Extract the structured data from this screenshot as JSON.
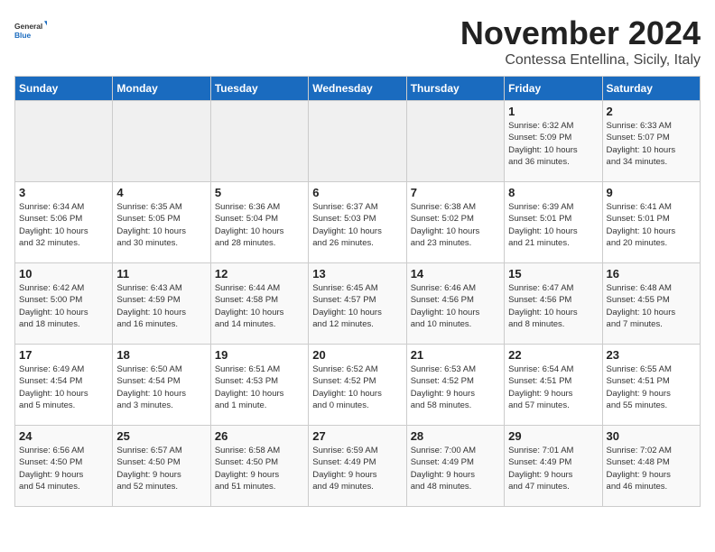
{
  "logo": {
    "general": "General",
    "blue": "Blue"
  },
  "title": "November 2024",
  "subtitle": "Contessa Entellina, Sicily, Italy",
  "weekdays": [
    "Sunday",
    "Monday",
    "Tuesday",
    "Wednesday",
    "Thursday",
    "Friday",
    "Saturday"
  ],
  "weeks": [
    [
      {
        "day": "",
        "info": ""
      },
      {
        "day": "",
        "info": ""
      },
      {
        "day": "",
        "info": ""
      },
      {
        "day": "",
        "info": ""
      },
      {
        "day": "",
        "info": ""
      },
      {
        "day": "1",
        "info": "Sunrise: 6:32 AM\nSunset: 5:09 PM\nDaylight: 10 hours\nand 36 minutes."
      },
      {
        "day": "2",
        "info": "Sunrise: 6:33 AM\nSunset: 5:07 PM\nDaylight: 10 hours\nand 34 minutes."
      }
    ],
    [
      {
        "day": "3",
        "info": "Sunrise: 6:34 AM\nSunset: 5:06 PM\nDaylight: 10 hours\nand 32 minutes."
      },
      {
        "day": "4",
        "info": "Sunrise: 6:35 AM\nSunset: 5:05 PM\nDaylight: 10 hours\nand 30 minutes."
      },
      {
        "day": "5",
        "info": "Sunrise: 6:36 AM\nSunset: 5:04 PM\nDaylight: 10 hours\nand 28 minutes."
      },
      {
        "day": "6",
        "info": "Sunrise: 6:37 AM\nSunset: 5:03 PM\nDaylight: 10 hours\nand 26 minutes."
      },
      {
        "day": "7",
        "info": "Sunrise: 6:38 AM\nSunset: 5:02 PM\nDaylight: 10 hours\nand 23 minutes."
      },
      {
        "day": "8",
        "info": "Sunrise: 6:39 AM\nSunset: 5:01 PM\nDaylight: 10 hours\nand 21 minutes."
      },
      {
        "day": "9",
        "info": "Sunrise: 6:41 AM\nSunset: 5:01 PM\nDaylight: 10 hours\nand 20 minutes."
      }
    ],
    [
      {
        "day": "10",
        "info": "Sunrise: 6:42 AM\nSunset: 5:00 PM\nDaylight: 10 hours\nand 18 minutes."
      },
      {
        "day": "11",
        "info": "Sunrise: 6:43 AM\nSunset: 4:59 PM\nDaylight: 10 hours\nand 16 minutes."
      },
      {
        "day": "12",
        "info": "Sunrise: 6:44 AM\nSunset: 4:58 PM\nDaylight: 10 hours\nand 14 minutes."
      },
      {
        "day": "13",
        "info": "Sunrise: 6:45 AM\nSunset: 4:57 PM\nDaylight: 10 hours\nand 12 minutes."
      },
      {
        "day": "14",
        "info": "Sunrise: 6:46 AM\nSunset: 4:56 PM\nDaylight: 10 hours\nand 10 minutes."
      },
      {
        "day": "15",
        "info": "Sunrise: 6:47 AM\nSunset: 4:56 PM\nDaylight: 10 hours\nand 8 minutes."
      },
      {
        "day": "16",
        "info": "Sunrise: 6:48 AM\nSunset: 4:55 PM\nDaylight: 10 hours\nand 7 minutes."
      }
    ],
    [
      {
        "day": "17",
        "info": "Sunrise: 6:49 AM\nSunset: 4:54 PM\nDaylight: 10 hours\nand 5 minutes."
      },
      {
        "day": "18",
        "info": "Sunrise: 6:50 AM\nSunset: 4:54 PM\nDaylight: 10 hours\nand 3 minutes."
      },
      {
        "day": "19",
        "info": "Sunrise: 6:51 AM\nSunset: 4:53 PM\nDaylight: 10 hours\nand 1 minute."
      },
      {
        "day": "20",
        "info": "Sunrise: 6:52 AM\nSunset: 4:52 PM\nDaylight: 10 hours\nand 0 minutes."
      },
      {
        "day": "21",
        "info": "Sunrise: 6:53 AM\nSunset: 4:52 PM\nDaylight: 9 hours\nand 58 minutes."
      },
      {
        "day": "22",
        "info": "Sunrise: 6:54 AM\nSunset: 4:51 PM\nDaylight: 9 hours\nand 57 minutes."
      },
      {
        "day": "23",
        "info": "Sunrise: 6:55 AM\nSunset: 4:51 PM\nDaylight: 9 hours\nand 55 minutes."
      }
    ],
    [
      {
        "day": "24",
        "info": "Sunrise: 6:56 AM\nSunset: 4:50 PM\nDaylight: 9 hours\nand 54 minutes."
      },
      {
        "day": "25",
        "info": "Sunrise: 6:57 AM\nSunset: 4:50 PM\nDaylight: 9 hours\nand 52 minutes."
      },
      {
        "day": "26",
        "info": "Sunrise: 6:58 AM\nSunset: 4:50 PM\nDaylight: 9 hours\nand 51 minutes."
      },
      {
        "day": "27",
        "info": "Sunrise: 6:59 AM\nSunset: 4:49 PM\nDaylight: 9 hours\nand 49 minutes."
      },
      {
        "day": "28",
        "info": "Sunrise: 7:00 AM\nSunset: 4:49 PM\nDaylight: 9 hours\nand 48 minutes."
      },
      {
        "day": "29",
        "info": "Sunrise: 7:01 AM\nSunset: 4:49 PM\nDaylight: 9 hours\nand 47 minutes."
      },
      {
        "day": "30",
        "info": "Sunrise: 7:02 AM\nSunset: 4:48 PM\nDaylight: 9 hours\nand 46 minutes."
      }
    ]
  ]
}
